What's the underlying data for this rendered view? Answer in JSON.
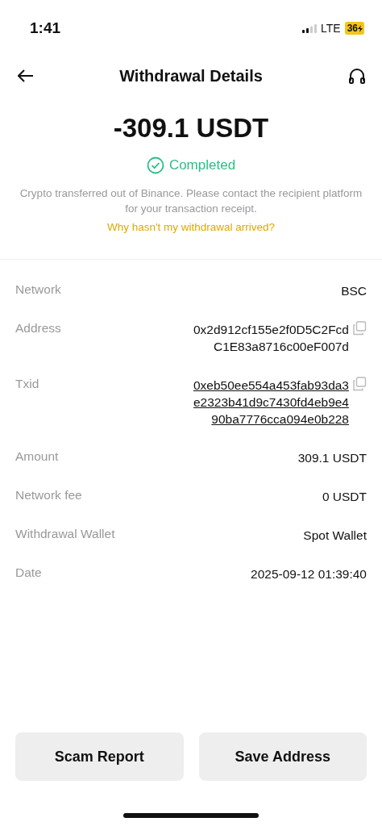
{
  "status_bar": {
    "time": "1:41",
    "network": "LTE",
    "battery": "36"
  },
  "header": {
    "title": "Withdrawal Details"
  },
  "summary": {
    "amount": "-309.1 USDT",
    "status": {
      "kind": "success",
      "label": "Completed"
    },
    "note": "Crypto transferred out of Binance. Please contact the recipient platform for your transaction receipt.",
    "help_link": "Why hasn't my withdrawal arrived?"
  },
  "details": [
    {
      "label": "Network",
      "kind": "plain",
      "value": [
        "BSC"
      ]
    },
    {
      "label": "Address",
      "kind": "copy",
      "value": [
        "0x2d912cf155e2f0D5C2Fcd",
        "C1E83a8716c00eF007d"
      ]
    },
    {
      "label": "Txid",
      "kind": "link",
      "value": [
        "0xeb50ee554a453fab93da3",
        "e2323b41d9c7430fd4eb9e4",
        "90ba7776cca094e0b228"
      ]
    },
    {
      "label": "Amount",
      "kind": "plain",
      "value": [
        "309.1 USDT"
      ]
    },
    {
      "label": "Network fee",
      "kind": "plain",
      "value": [
        "0 USDT"
      ]
    },
    {
      "label": "Withdrawal Wallet",
      "kind": "plain",
      "value": [
        "Spot Wallet"
      ]
    },
    {
      "label": "Date",
      "kind": "plain",
      "value": [
        "2025-09-12 01:39:40"
      ]
    }
  ],
  "buttons": [
    "Scam Report",
    "Save Address"
  ]
}
